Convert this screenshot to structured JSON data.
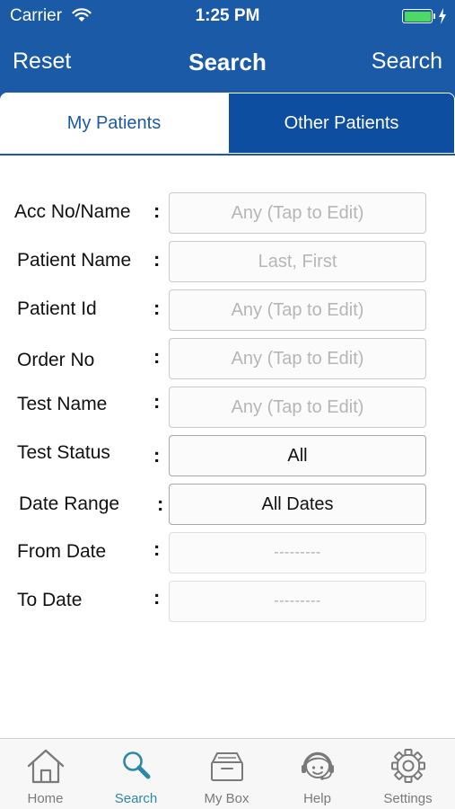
{
  "status_bar": {
    "carrier": "Carrier",
    "time": "1:25 PM",
    "battery_level": 1.0
  },
  "nav": {
    "left_button": "Reset",
    "title": "Search",
    "right_button": "Search"
  },
  "segments": {
    "selected": "My Patients",
    "items": [
      "My Patients",
      "Other Patients"
    ]
  },
  "form": {
    "fields": [
      {
        "label": "Acc No/Name",
        "value": "Any (Tap to Edit)",
        "kind": "placeholder"
      },
      {
        "label": "Patient Name",
        "value": "Last, First",
        "kind": "placeholder"
      },
      {
        "label": "Patient Id",
        "value": "Any (Tap to Edit)",
        "kind": "placeholder"
      },
      {
        "label": "Order No",
        "value": "Any (Tap to Edit)",
        "kind": "placeholder"
      },
      {
        "label": "Test Name",
        "value": "Any (Tap to Edit)",
        "kind": "placeholder"
      },
      {
        "label": "Test Status",
        "value": "All",
        "kind": "select"
      },
      {
        "label": "Date Range",
        "value": "All Dates",
        "kind": "select"
      },
      {
        "label": "From Date",
        "value": "---------",
        "kind": "date-disabled"
      },
      {
        "label": "To Date",
        "value": "---------",
        "kind": "date-disabled"
      }
    ],
    "colon": ":"
  },
  "tab_bar": {
    "selected": "Search",
    "items": [
      {
        "label": "Home",
        "icon": "house-icon"
      },
      {
        "label": "Search",
        "icon": "magnifier-icon"
      },
      {
        "label": "My Box",
        "icon": "inbox-tray-icon"
      },
      {
        "label": "Help",
        "icon": "support-headset-icon"
      },
      {
        "label": "Settings",
        "icon": "gear-icon"
      }
    ]
  },
  "colors": {
    "brand_blue": "#1b5aa7",
    "segment_selected_bg": "#0d4ea0",
    "battery_green": "#4cd964",
    "active_tab": "#2a89a6",
    "inactive_tab": "#7a7a7a"
  }
}
